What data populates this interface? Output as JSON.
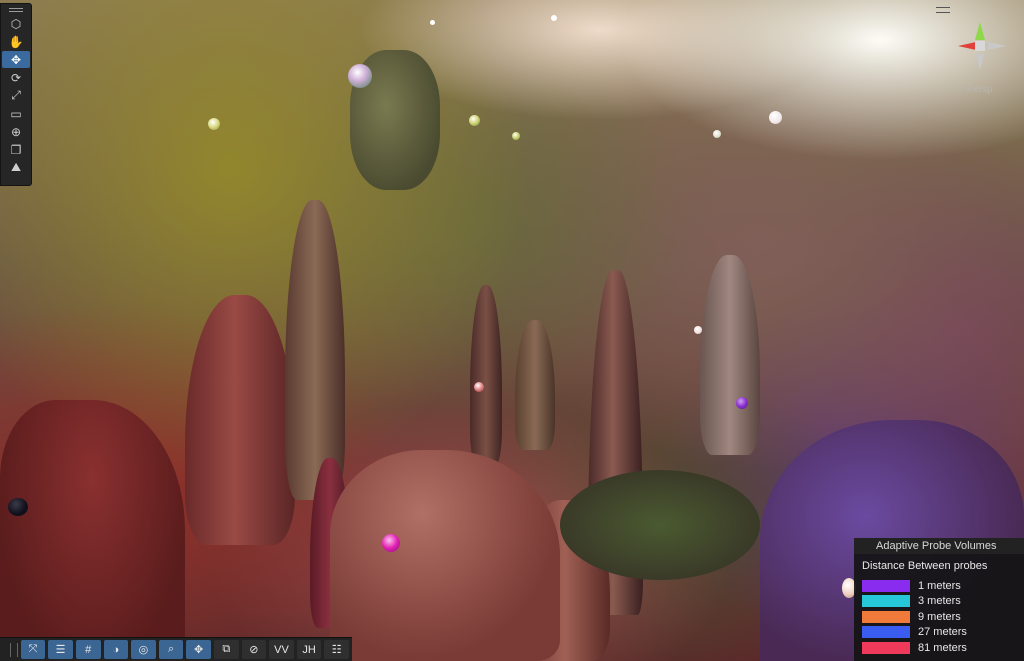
{
  "toolbar_left": {
    "tools": [
      {
        "icon": "view-tool-icon",
        "active": false
      },
      {
        "icon": "hand-tool-icon",
        "active": false
      },
      {
        "icon": "move-tool-icon",
        "active": true
      },
      {
        "icon": "rotate-tool-icon",
        "active": false
      },
      {
        "icon": "scale-tool-icon",
        "active": false
      },
      {
        "icon": "rect-tool-icon",
        "active": false
      },
      {
        "icon": "transform-tool-icon",
        "active": false
      },
      {
        "icon": "custom-tool-icon",
        "active": false
      },
      {
        "icon": "probe-edit-tool-icon",
        "active": false
      }
    ]
  },
  "gizmo": {
    "projection_label": "< Persp",
    "colors": {
      "x": "#e2403a",
      "y": "#8fd84a",
      "z": "#4a7fd8",
      "neutral": "#c8c8c8"
    }
  },
  "bottom_toolbar": {
    "buttons": [
      {
        "name": "transform-handles-button",
        "label": "⤧",
        "on": true
      },
      {
        "name": "sorting-button",
        "label": "☰",
        "on": true
      },
      {
        "name": "grid-button",
        "label": "#",
        "on": true
      },
      {
        "name": "snap-button",
        "label": "◑",
        "on": true
      },
      {
        "name": "orbit-button",
        "label": "◎",
        "on": true
      },
      {
        "name": "search-button",
        "label": "⌕",
        "on": true
      },
      {
        "name": "pivot-button",
        "label": "✥",
        "on": true
      },
      {
        "name": "layers-button",
        "label": "⧉",
        "on": false
      },
      {
        "name": "compass-button",
        "label": "⊘",
        "on": false
      },
      {
        "name": "vv-button",
        "label": "VV",
        "on": false
      },
      {
        "name": "jh-button",
        "label": "JH",
        "on": false
      },
      {
        "name": "list-button",
        "label": "☷",
        "on": false
      }
    ]
  },
  "overlay": {
    "title": "Adaptive Probe Volumes",
    "subtitle": "Distance Between probes",
    "legend": [
      {
        "label": "1 meters",
        "color": "#8a2cf0"
      },
      {
        "label": "3 meters",
        "color": "#26c7d9"
      },
      {
        "label": "9 meters",
        "color": "#f07a3a"
      },
      {
        "label": "27 meters",
        "color": "#3b5cf0"
      },
      {
        "label": "81 meters",
        "color": "#f03a5c"
      }
    ]
  }
}
